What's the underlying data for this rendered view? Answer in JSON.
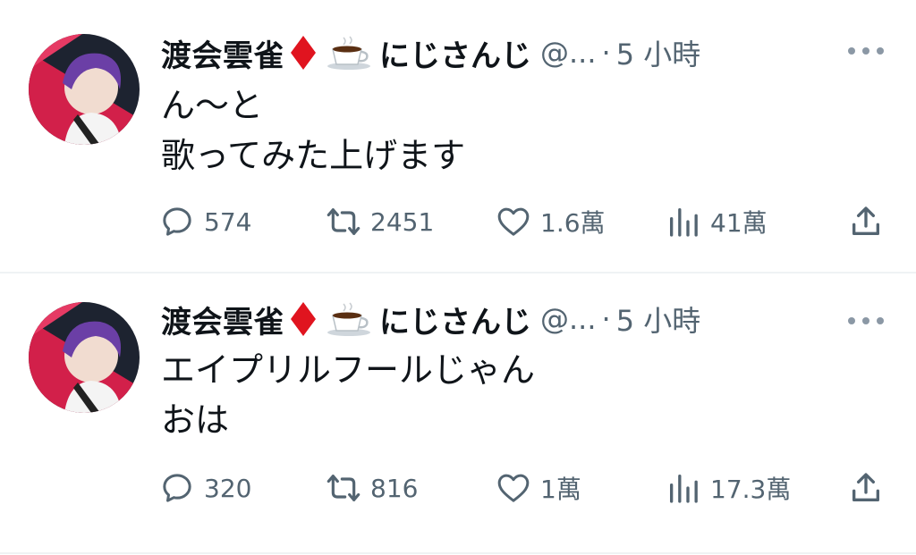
{
  "tweets": [
    {
      "author": {
        "name": "渡会雲雀",
        "affiliation": "にじさんじ",
        "handle": "@...",
        "time": "5 小時"
      },
      "text_lines": [
        "ん～と",
        "歌ってみた上げます"
      ],
      "stats": {
        "replies": "574",
        "retweets": "2451",
        "likes": "1.6萬",
        "views": "41萬"
      }
    },
    {
      "author": {
        "name": "渡会雲雀",
        "affiliation": "にじさんじ",
        "handle": "@...",
        "time": "5 小時"
      },
      "text_lines": [
        "エイプリルフールじゃん",
        "おは"
      ],
      "stats": {
        "replies": "320",
        "retweets": "816",
        "likes": "1萬",
        "views": "17.3萬"
      }
    }
  ],
  "icons": {
    "reply": "reply-icon",
    "retweet": "retweet-icon",
    "like": "heart-icon",
    "views": "bar-chart-icon",
    "share": "share-icon",
    "more": "more-dots-icon",
    "diamond": "red-diamond-emoji",
    "coffee": "coffee-cup-emoji"
  },
  "colors": {
    "meta_text": "#536471",
    "text": "#0f1419",
    "diamond": "#e0141f"
  }
}
